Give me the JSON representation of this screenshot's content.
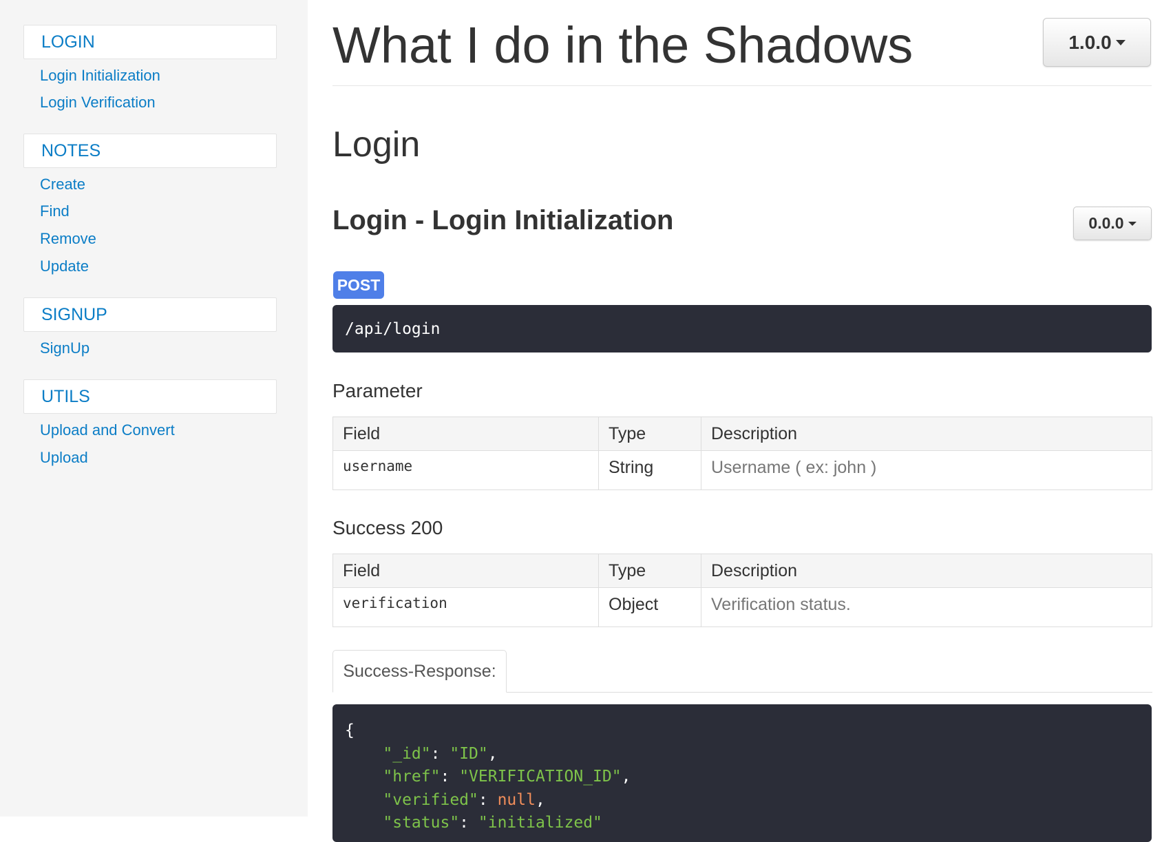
{
  "sidebar": {
    "groups": [
      {
        "title": "LOGIN",
        "items": [
          "Login Initialization",
          "Login Verification"
        ]
      },
      {
        "title": "NOTES",
        "items": [
          "Create",
          "Find",
          "Remove",
          "Update"
        ]
      },
      {
        "title": "SIGNUP",
        "items": [
          "SignUp"
        ]
      },
      {
        "title": "UTILS",
        "items": [
          "Upload and Convert",
          "Upload"
        ]
      }
    ]
  },
  "header": {
    "title": "What I do in the Shadows",
    "version": "1.0.0"
  },
  "section": {
    "title": "Login"
  },
  "endpoint": {
    "title": "Login - Login Initialization",
    "version": "0.0.0",
    "method": "POST",
    "url": "/api/login",
    "parameter": {
      "heading": "Parameter",
      "columns": [
        "Field",
        "Type",
        "Description"
      ],
      "rows": [
        {
          "field": "username",
          "type": "String",
          "description": "Username ( ex: john )"
        }
      ]
    },
    "success": {
      "heading": "Success 200",
      "columns": [
        "Field",
        "Type",
        "Description"
      ],
      "rows": [
        {
          "field": "verification",
          "type": "Object",
          "description": "Verification status."
        }
      ]
    },
    "example_tab": "Success-Response:",
    "example_code": {
      "open_brace": "{",
      "lines": [
        {
          "key": "\"_id\"",
          "value": "\"ID\"",
          "kind": "string"
        },
        {
          "key": "\"href\"",
          "value": "\"VERIFICATION_ID\"",
          "kind": "string"
        },
        {
          "key": "\"verified\"",
          "value": "null",
          "kind": "null"
        },
        {
          "key": "\"status\"",
          "value": "\"initialized\"",
          "kind": "string"
        }
      ]
    }
  },
  "colors": {
    "link": "#0b7dc6",
    "method_post": "#4f7fe8",
    "code_bg": "#2b2d38",
    "code_string": "#7ec34a",
    "code_null": "#f08d5a"
  }
}
